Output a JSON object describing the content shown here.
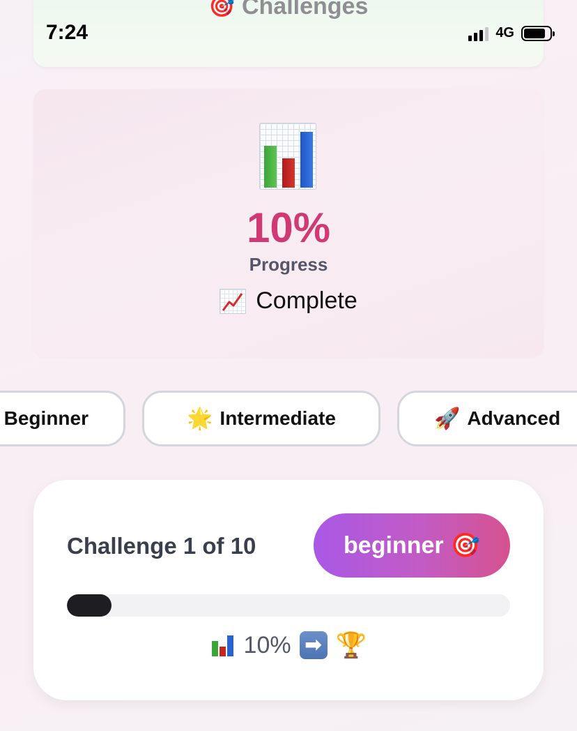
{
  "status_bar": {
    "time": "7:24",
    "network": "4G"
  },
  "header": {
    "icon": "direct-hit-icon",
    "title": "Challenges",
    "emoji": "🎯"
  },
  "progress_card": {
    "icon": "bar-chart-icon",
    "percent_text": "10%",
    "label": "Progress",
    "status_icon": "chart-increasing-icon",
    "status_text": "Complete"
  },
  "levels": [
    {
      "label": "Beginner",
      "icon": ""
    },
    {
      "label": "Intermediate",
      "icon": "glowing-star-icon",
      "emoji": "🌟"
    },
    {
      "label": "Advanced",
      "icon": "rocket-icon",
      "emoji": "🚀"
    }
  ],
  "challenge_card": {
    "title": "Challenge 1 of 10",
    "badge_label": "beginner",
    "badge_emoji": "🎯",
    "progress_fraction": 0.1,
    "summary_percent": "10%",
    "summary_arrow": "➡",
    "summary_trophy": "🏆"
  },
  "colors": {
    "percent_pink": "#d03a74",
    "badge_gradient_start": "#a958e6",
    "badge_gradient_end": "#d6528f",
    "track_fill": "#1d1d22"
  }
}
